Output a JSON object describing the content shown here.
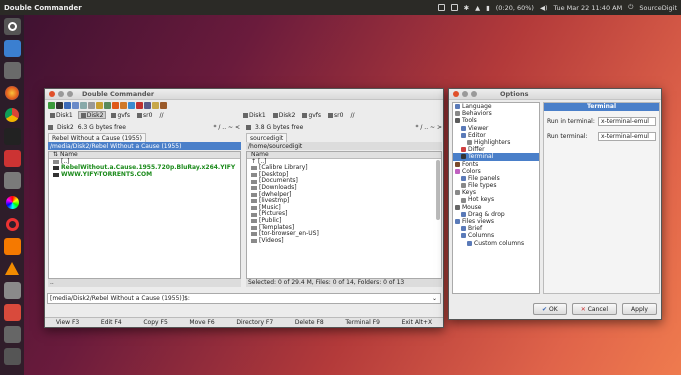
{
  "top_panel": {
    "app_name": "Double Commander",
    "battery": "(0:20, 60%)",
    "clock": "Tue Mar 22 11:40 AM",
    "user": "SourceDigit"
  },
  "dc": {
    "title": "Double Commander",
    "drives_left": [
      "Disk1",
      "Disk2",
      "gvfs",
      "sr0",
      "//"
    ],
    "drives_right": [
      "Disk1",
      "Disk2",
      "gvfs",
      "sr0",
      "//"
    ],
    "left": {
      "disk": "Disk2",
      "free": "6.3 G bytes free",
      "tab": "Rebel Without a Cause (1955)",
      "path": "/media/Disk2/Rebel Without a Cause (1955)",
      "col_name": "Name",
      "rows": [
        {
          "name": "[..]",
          "type": "up"
        },
        {
          "name": "RebelWithout.a.Cause.1955.720p.BluRay.x264.YIFY",
          "type": "file"
        },
        {
          "name": "WWW.YIFY-TORRENTS.COM",
          "type": "file"
        }
      ]
    },
    "right": {
      "free": "3.8 G bytes free",
      "tab": "sourcedigit",
      "path": "/home/sourcedigit",
      "col_name": "Name",
      "rows": [
        {
          "name": "[..]"
        },
        {
          "name": "[Calibre Library]"
        },
        {
          "name": "[Desktop]"
        },
        {
          "name": "[Documents]"
        },
        {
          "name": "[Downloads]"
        },
        {
          "name": "[dwhelper]"
        },
        {
          "name": "[livestmp]"
        },
        {
          "name": "[Music]"
        },
        {
          "name": "[Pictures]"
        },
        {
          "name": "[Public]"
        },
        {
          "name": "[Templates]"
        },
        {
          "name": "[tor-browser_en-US]"
        },
        {
          "name": "[Videos]"
        }
      ],
      "status": "Selected: 0 of 29.4 M, Files: 0 of 14, Folders: 0 of 13"
    },
    "left_status": "..",
    "cmdline": "[media/Disk2/Rebel Without a Cause (1955)]$:",
    "fkeys": [
      "View F3",
      "Edit F4",
      "Copy F5",
      "Move F6",
      "Directory F7",
      "Delete F8",
      "Terminal F9",
      "Exit Alt+X"
    ]
  },
  "options": {
    "title": "Options",
    "tree": [
      {
        "label": "Language",
        "level": 0,
        "color": "#5a7ab8"
      },
      {
        "label": "Behaviors",
        "level": 0,
        "color": "#888"
      },
      {
        "label": "Tools",
        "level": 0,
        "color": "#5a5a5a"
      },
      {
        "label": "Viewer",
        "level": 1,
        "color": "#5a7ab8"
      },
      {
        "label": "Editor",
        "level": 1,
        "color": "#5a7ab8"
      },
      {
        "label": "Highlighters",
        "level": 2,
        "color": "#888"
      },
      {
        "label": "Differ",
        "level": 1,
        "color": "#d04040"
      },
      {
        "label": "Terminal",
        "level": 1,
        "color": "#333",
        "selected": true
      },
      {
        "label": "Fonts",
        "level": 0,
        "color": "#7a4a2a"
      },
      {
        "label": "Colors",
        "level": 0,
        "color": "#c060c0"
      },
      {
        "label": "File panels",
        "level": 1,
        "color": "#5a7ab8"
      },
      {
        "label": "File types",
        "level": 1,
        "color": "#888"
      },
      {
        "label": "Keys",
        "level": 0,
        "color": "#888"
      },
      {
        "label": "Hot keys",
        "level": 1,
        "color": "#888"
      },
      {
        "label": "Mouse",
        "level": 0,
        "color": "#666"
      },
      {
        "label": "Drag & drop",
        "level": 1,
        "color": "#5a7ab8"
      },
      {
        "label": "Files views",
        "level": 0,
        "color": "#5a7ab8"
      },
      {
        "label": "Brief",
        "level": 1,
        "color": "#5a7ab8"
      },
      {
        "label": "Columns",
        "level": 1,
        "color": "#5a7ab8"
      },
      {
        "label": "Custom columns",
        "level": 2,
        "color": "#5a7ab8"
      }
    ],
    "header": "Terminal",
    "run_in_terminal_label": "Run in terminal:",
    "run_in_terminal_value": "x-terminal-emul",
    "run_terminal_label": "Run terminal:",
    "run_terminal_value": "x-terminal-emul",
    "ok": "OK",
    "cancel": "Cancel",
    "apply": "Apply"
  },
  "colors": {
    "accent": "#4a7fc9",
    "green_file": "#1a8a1a"
  }
}
